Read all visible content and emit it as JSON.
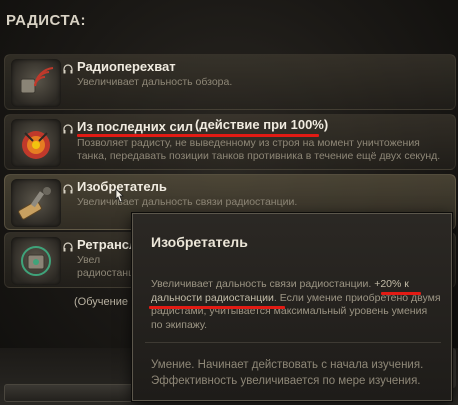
{
  "section": {
    "title": "РАДИСТА:"
  },
  "skills": [
    {
      "name": "Радиоперехват",
      "desc": "Увеличивает дальность обзора.",
      "icon": "radio-intercept-icon"
    },
    {
      "name": "Из последних сил",
      "badge": "(действие при 100%)",
      "desc": "Позволяет радисту, не выведенному из строя на момент уничтожения танка, передавать позиции танков противника в течение ещё двух секунд.",
      "icon": "last-effort-icon"
    },
    {
      "name": "Изобретатель",
      "desc": "Увеличивает дальность связи радиостанции.",
      "icon": "inventor-icon"
    },
    {
      "name": "Ретрансл",
      "desc_line1": "Увел",
      "desc_line2": "радиостанци",
      "icon": "relay-icon"
    }
  ],
  "training_note": "(Обучение д",
  "tooltip": {
    "title": "Изобретатель",
    "desc_part1": "Увеличивает дальность связи радиостанции. ",
    "desc_highlight": "+20% к дальности радиостанции",
    "desc_part2": ". Если умение приобретено двумя радистами, учитывается максимальный уровень умения по экипажу.",
    "footer": "Умение. Начинает действовать с начала изучения. Эффективность увеличивается по мере изучения."
  },
  "colors": {
    "accent_red": "#e21b14",
    "title_text": "#f0ebe0",
    "desc_text": "#8e8777"
  }
}
